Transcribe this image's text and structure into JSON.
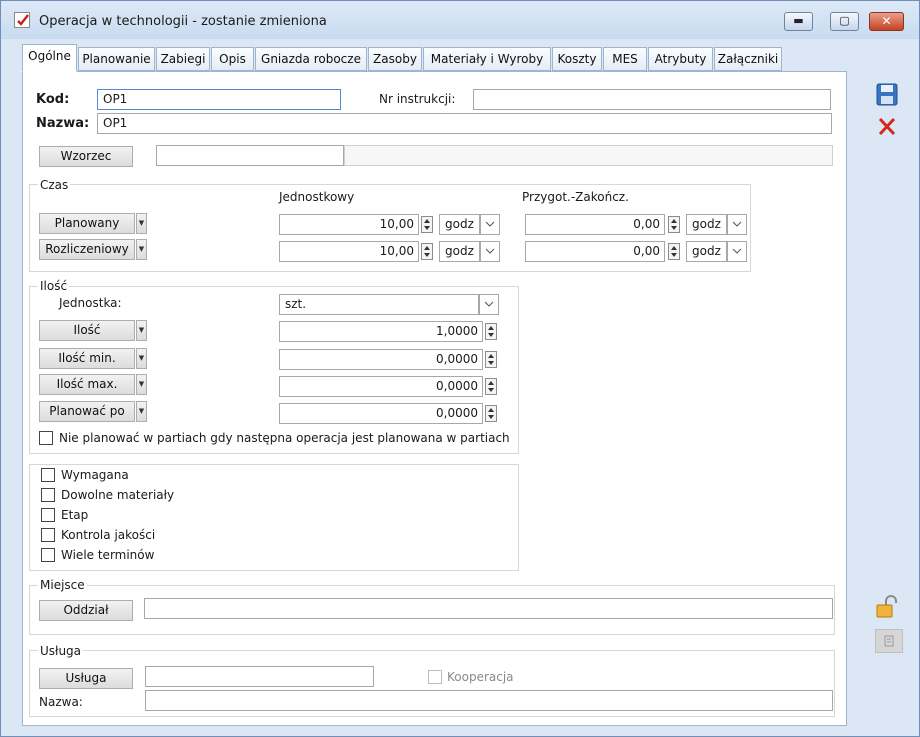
{
  "window": {
    "title": "Operacja w technologii - zostanie zmieniona",
    "minimize": "▬",
    "maximize": "▢",
    "close": "✕"
  },
  "tabs": [
    "Ogólne",
    "Planowanie",
    "Zabiegi",
    "Opis",
    "Gniazda robocze",
    "Zasoby",
    "Materiały i Wyroby",
    "Koszty",
    "MES",
    "Atrybuty",
    "Załączniki"
  ],
  "header": {
    "kod_label": "Kod:",
    "kod_value": "OP1",
    "nr_instrukcji_label": "Nr instrukcji:",
    "nr_instrukcji_value": "",
    "nazwa_label": "Nazwa:",
    "nazwa_value": "OP1",
    "wzorzec_button": "Wzorzec",
    "wzorzec_value": ""
  },
  "czas": {
    "legend": "Czas",
    "col1": "Jednostkowy",
    "col2": "Przygot.-Zakończ.",
    "rows": [
      {
        "button": "Planowany",
        "unit_value": "10,00",
        "unit": "godz",
        "prep_value": "0,00",
        "prep_unit": "godz"
      },
      {
        "button": "Rozliczeniowy",
        "unit_value": "10,00",
        "unit": "godz",
        "prep_value": "0,00",
        "prep_unit": "godz"
      }
    ]
  },
  "ilosc": {
    "legend": "Ilość",
    "jednostka_label": "Jednostka:",
    "jednostka_value": "szt.",
    "rows": [
      {
        "button": "Ilość",
        "value": "1,0000"
      },
      {
        "button": "Ilość min.",
        "value": "0,0000"
      },
      {
        "button": "Ilość max.",
        "value": "0,0000"
      },
      {
        "button": "Planować po",
        "value": "0,0000"
      }
    ],
    "nie_planowac": "Nie planować w partiach gdy następna operacja jest planowana w partiach"
  },
  "flags": [
    "Wymagana",
    "Dowolne materiały",
    "Etap",
    "Kontrola jakości",
    "Wiele terminów"
  ],
  "miejsce": {
    "legend": "Miejsce",
    "oddzial_button": "Oddział",
    "oddzial_value": ""
  },
  "usluga": {
    "legend": "Usługa",
    "usluga_button": "Usługa",
    "usluga_value": "",
    "kooperacja": "Kooperacja",
    "nazwa_label": "Nazwa:",
    "nazwa_value": ""
  }
}
